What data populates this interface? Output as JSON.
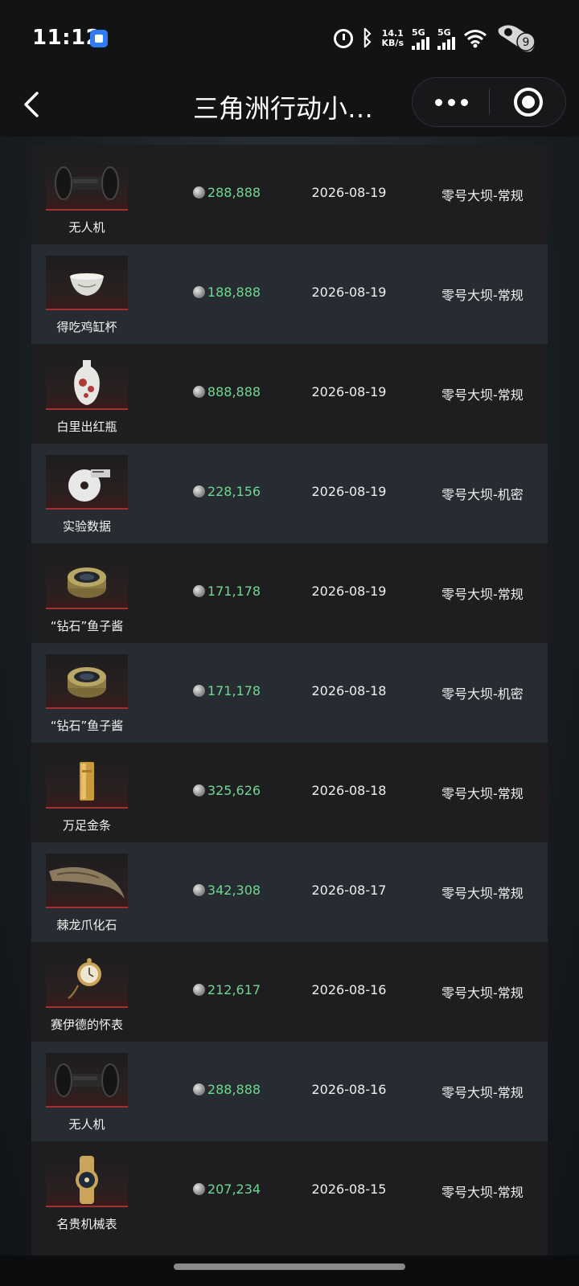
{
  "status_bar": {
    "time": "11:12",
    "net_speed_value": "14.1",
    "net_speed_unit": "KB/s",
    "sim1_label": "5G",
    "sim2_label": "5G",
    "battery_level": "9"
  },
  "nav": {
    "title": "三角洲行动小…"
  },
  "colors": {
    "price_green": "#6fd88f",
    "row_dark": "#1e1e20",
    "row_light": "#262c31",
    "thumb_accent": "#a23232"
  },
  "items": [
    {
      "name": "无人机",
      "price": "288,888",
      "date": "2026-08-19",
      "map": "零号大坝-常规",
      "icon": "drone-icon"
    },
    {
      "name": "得吃鸡缸杯",
      "price": "188,888",
      "date": "2026-08-19",
      "map": "零号大坝-常规",
      "icon": "cup-icon"
    },
    {
      "name": "白里出红瓶",
      "price": "888,888",
      "date": "2026-08-19",
      "map": "零号大坝-常规",
      "icon": "vase-icon"
    },
    {
      "name": "实验数据",
      "price": "228,156",
      "date": "2026-08-19",
      "map": "零号大坝-机密",
      "icon": "disc-icon"
    },
    {
      "name": "“钻石”鱼子酱",
      "price": "171,178",
      "date": "2026-08-19",
      "map": "零号大坝-常规",
      "icon": "caviar-icon"
    },
    {
      "name": "“钻石”鱼子酱",
      "price": "171,178",
      "date": "2026-08-18",
      "map": "零号大坝-机密",
      "icon": "caviar-icon"
    },
    {
      "name": "万足金条",
      "price": "325,626",
      "date": "2026-08-18",
      "map": "零号大坝-常规",
      "icon": "gold-bar-icon"
    },
    {
      "name": "棘龙爪化石",
      "price": "342,308",
      "date": "2026-08-17",
      "map": "零号大坝-常规",
      "icon": "claw-fossil-icon"
    },
    {
      "name": "赛伊德的怀表",
      "price": "212,617",
      "date": "2026-08-16",
      "map": "零号大坝-常规",
      "icon": "pocket-watch-icon"
    },
    {
      "name": "无人机",
      "price": "288,888",
      "date": "2026-08-16",
      "map": "零号大坝-常规",
      "icon": "drone-icon"
    },
    {
      "name": "名贵机械表",
      "price": "207,234",
      "date": "2026-08-15",
      "map": "零号大坝-常规",
      "icon": "watch-icon"
    }
  ]
}
